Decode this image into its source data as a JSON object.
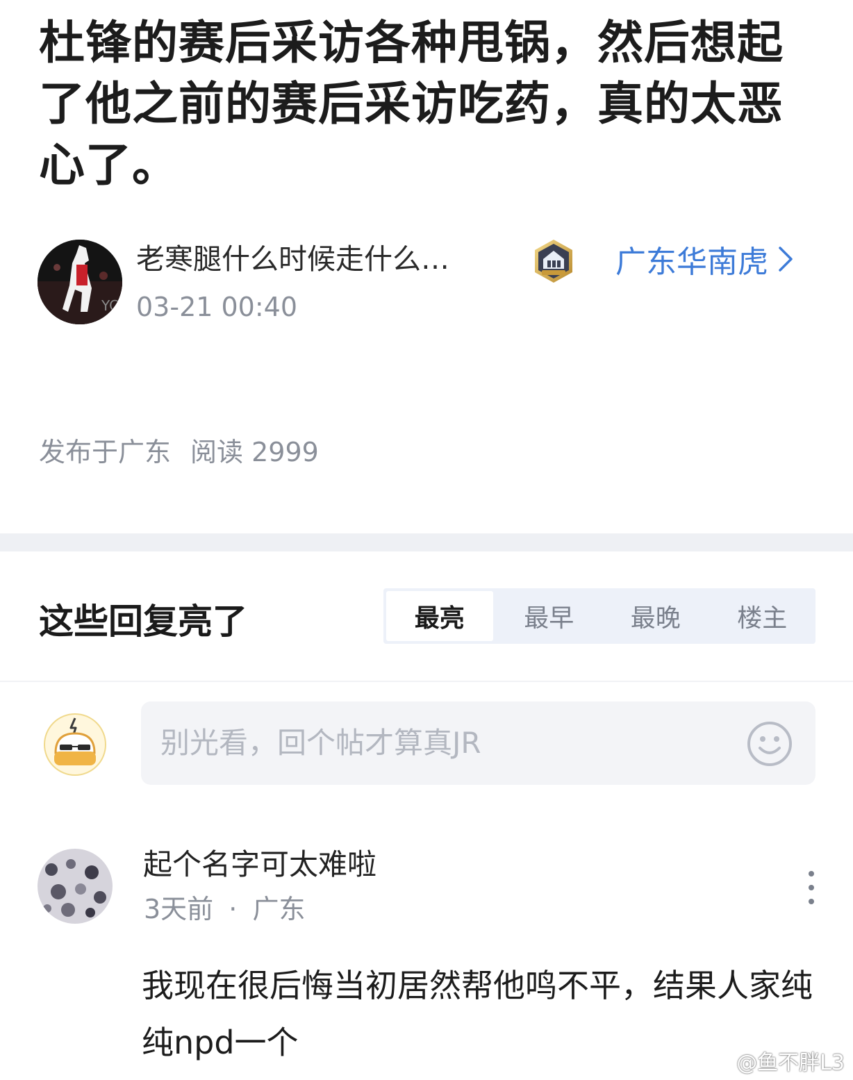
{
  "post": {
    "title": "杜锋的赛后采访各种甩锅，然后想起了他之前的赛后采访吃药，真的太恶心了。",
    "author": "老寒腿什么时候走什么…",
    "time": "03-21 00:40",
    "board": "广东华南虎",
    "location": "发布于广东",
    "reads": "阅读 2999"
  },
  "replies": {
    "section_title": "这些回复亮了",
    "sort_tabs": [
      {
        "label": "最亮",
        "active": true
      },
      {
        "label": "最早",
        "active": false
      },
      {
        "label": "最晚",
        "active": false
      },
      {
        "label": "楼主",
        "active": false
      }
    ],
    "input_placeholder": "别光看，回个帖才算真JR"
  },
  "comments": [
    {
      "user": "起个名字可太难啦",
      "time": "3天前",
      "sep": "·",
      "location": "广东",
      "text": "我现在很后悔当初居然帮他鸣不平，结果人家纯纯npd一个"
    }
  ],
  "watermark": "@鱼不胖L3",
  "colors": {
    "link": "#3d7bd8",
    "meta": "#8a8f99",
    "section_bg": "#eef0f4"
  }
}
